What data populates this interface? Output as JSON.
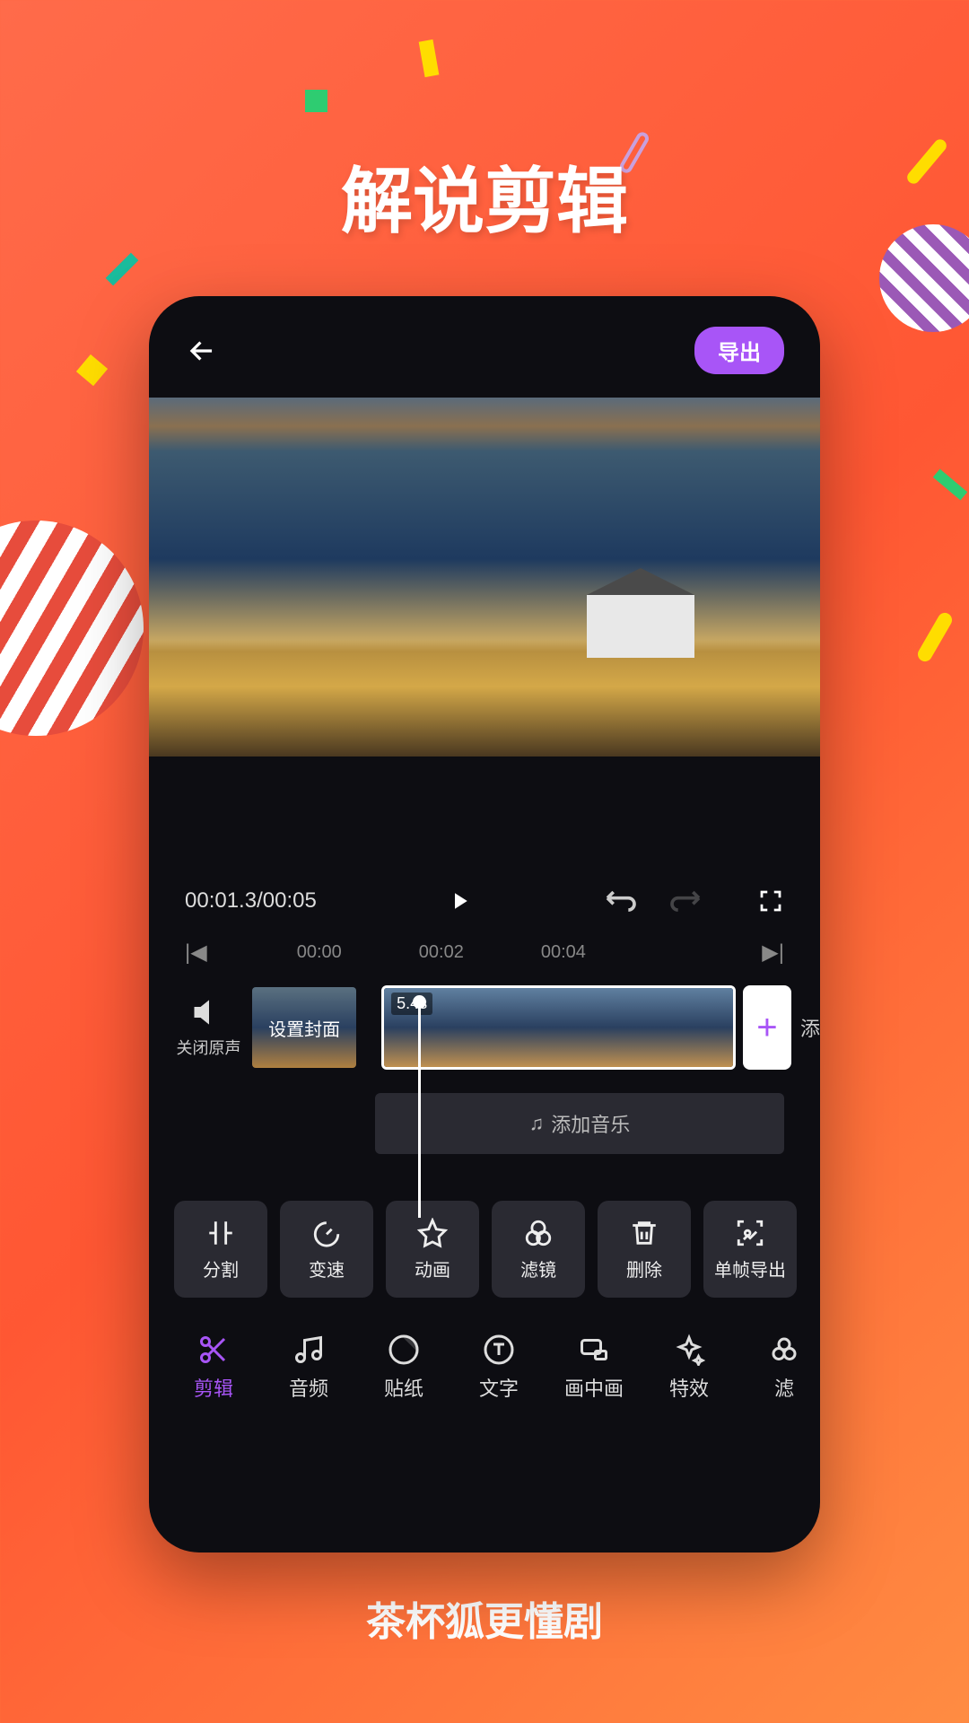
{
  "banner": {
    "title": "解说剪辑",
    "footer": "茶杯狐更懂剧"
  },
  "topbar": {
    "export": "导出"
  },
  "playback": {
    "current": "00:01.3",
    "total": "00:05"
  },
  "ruler": {
    "ticks": [
      "00:00",
      "00:02",
      "00:04"
    ]
  },
  "timeline": {
    "mute_label": "关闭原声",
    "cover_label": "设置封面",
    "clip_duration": "5.4s",
    "add_label": "添",
    "add_music": "添加音乐"
  },
  "tools": [
    {
      "label": "分割",
      "icon": "split"
    },
    {
      "label": "变速",
      "icon": "speed"
    },
    {
      "label": "动画",
      "icon": "anim"
    },
    {
      "label": "滤镜",
      "icon": "filter"
    },
    {
      "label": "删除",
      "icon": "delete"
    },
    {
      "label": "单帧导出",
      "icon": "frame"
    }
  ],
  "nav": [
    {
      "label": "剪辑",
      "icon": "cut",
      "active": true
    },
    {
      "label": "音频",
      "icon": "audio"
    },
    {
      "label": "贴纸",
      "icon": "sticker"
    },
    {
      "label": "文字",
      "icon": "text"
    },
    {
      "label": "画中画",
      "icon": "pip"
    },
    {
      "label": "特效",
      "icon": "fx"
    },
    {
      "label": "滤",
      "icon": "more"
    }
  ]
}
